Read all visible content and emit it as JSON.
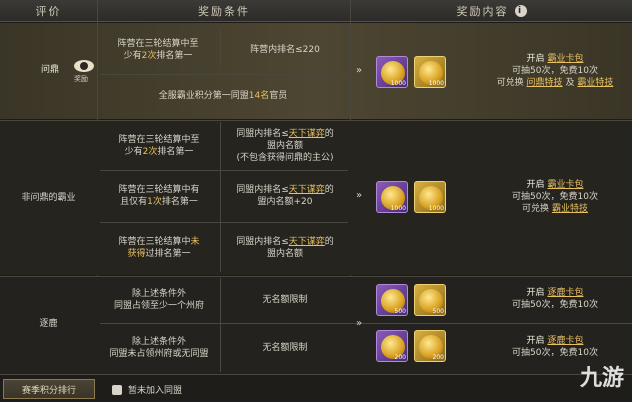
{
  "header": {
    "col_rating": "评价",
    "col_conditions": "奖励条件",
    "col_rewards": "奖励内容"
  },
  "rows": {
    "wending": {
      "rating": "问鼎",
      "reward_link": "奖励",
      "cond1_a": "阵营在三轮结算中至",
      "cond1_b": "少有",
      "cond1_c": "2次",
      "cond1_d": "排名第一",
      "cond1_right": "阵营内排名≤220",
      "cond2_a": "全服霸业积分第一同盟",
      "cond2_b": "14名",
      "cond2_c": "官员",
      "reward_open": "开启",
      "reward_pack": "霸业卡包",
      "reward_line2": "可抽50次，免费10次",
      "reward_line3a": "可兑换",
      "reward_line3b": "问鼎特技",
      "reward_line3c": "及",
      "reward_line3d": "霸业特技",
      "qty1": "1000",
      "qty2": "1000"
    },
    "fei": {
      "rating": "非问鼎的霸业",
      "r1_left_a": "阵营在三轮结算中至",
      "r1_left_b": "少有",
      "r1_left_c": "2次",
      "r1_left_d": "排名第一",
      "r1_right_a": "同盟内排名≤",
      "r1_right_b": "天下谋弈",
      "r1_right_c": "的",
      "r1_right_d": "盟内名额",
      "r1_right_e": "(不包含获得问鼎的主公)",
      "r2_left_a": "阵营在三轮结算中有",
      "r2_left_b": "且仅有",
      "r2_left_c": "1次",
      "r2_left_d": "排名第一",
      "r2_right_a": "同盟内排名≤",
      "r2_right_b": "天下谋弈",
      "r2_right_c": "的",
      "r2_right_d": "盟内名额+20",
      "r3_left_a": "阵营在三轮结算中",
      "r3_left_b": "未",
      "r3_left_c": "获得",
      "r3_left_d": "过排名第一",
      "r3_right_a": "同盟内排名≤",
      "r3_right_b": "天下谋弈",
      "r3_right_c": "的",
      "r3_right_d": "盟内名额",
      "reward_open": "开启",
      "reward_pack": "霸业卡包",
      "reward_line2": "可抽50次，免费10次",
      "reward_line3a": "可兑换",
      "reward_line3b": "霸业特技",
      "qty1": "1000",
      "qty2": "1000"
    },
    "zhulu": {
      "rating": "逐鹿",
      "r1_left_a": "除上述条件外",
      "r1_left_b": "同盟占领至少一个州府",
      "r1_right": "无名额限制",
      "r2_left_a": "除上述条件外",
      "r2_left_b": "同盟未占领州府或无同盟",
      "r2_right": "无名额限制",
      "reward1_open": "开启",
      "reward1_pack": "逐鹿卡包",
      "reward1_line2": "可抽50次，免费10次",
      "reward2_open": "开启",
      "reward2_pack": "逐鹿卡包",
      "reward2_line2": "可抽50次，免费10次",
      "qty1": "500",
      "qty2": "500",
      "qty3": "200",
      "qty4": "200"
    }
  },
  "arrows": "»",
  "bottom": {
    "button": "赛季积分排行",
    "status": "暂未加入同盟"
  },
  "watermark": "九游"
}
